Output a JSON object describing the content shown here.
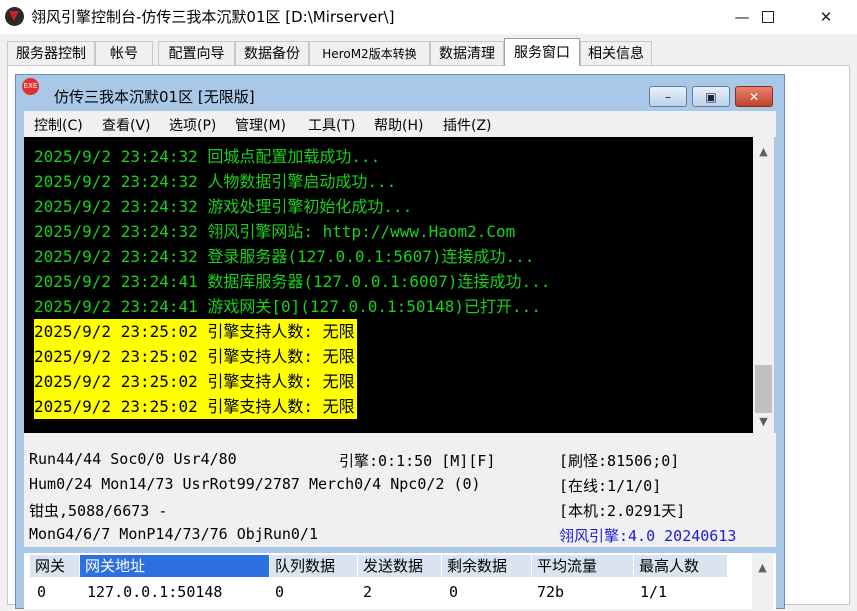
{
  "window": {
    "title": "翎风引擎控制台-仿传三我本沉默01区 [D:\\Mirserver\\]"
  },
  "tabs": [
    "服务器控制",
    "帐号",
    "配置向导",
    "数据备份",
    "HeroM2版本转换",
    "数据清理",
    "服务窗口",
    "相关信息"
  ],
  "active_tab": "服务窗口",
  "inner": {
    "title": "仿传三我本沉默01区 [无限版]",
    "icon_text": "EXE"
  },
  "menu": [
    "控制(C)",
    "查看(V)",
    "选项(P)",
    "管理(M)",
    "工具(T)",
    "帮助(H)",
    "插件(Z)"
  ],
  "log": [
    {
      "text": "2025/9/2 23:24:32 回城点配置加载成功...",
      "style": "green"
    },
    {
      "text": "2025/9/2 23:24:32 人物数据引擎启动成功...",
      "style": "green"
    },
    {
      "text": "2025/9/2 23:24:32 游戏处理引擎初始化成功...",
      "style": "green"
    },
    {
      "text": "2025/9/2 23:24:32 翎风引擎网站: http://www.Haom2.Com",
      "style": "green"
    },
    {
      "text": "2025/9/2 23:24:32 登录服务器(127.0.0.1:5607)连接成功...",
      "style": "green"
    },
    {
      "text": "2025/9/2 23:24:41 数据库服务器(127.0.0.1:6007)连接成功...",
      "style": "green"
    },
    {
      "text": "2025/9/2 23:24:41 游戏网关[0](127.0.0.1:50148)已打开...",
      "style": "green"
    },
    {
      "text": "2025/9/2 23:25:02 引擎支持人数: 无限",
      "style": "yellow"
    },
    {
      "text": "2025/9/2 23:25:02 引擎支持人数: 无限",
      "style": "yellow"
    },
    {
      "text": "2025/9/2 23:25:02 引擎支持人数: 无限",
      "style": "yellow"
    },
    {
      "text": "2025/9/2 23:25:02 引擎支持人数: 无限",
      "style": "yellow"
    }
  ],
  "status": {
    "run": "Run44/44 Soc0/0 Usr4/80",
    "engine_time": "引擎:0:1:50 [M][F]",
    "monster": "[刷怪:81506;0]",
    "hum": "Hum0/24 Mon14/73 UsrRot99/2787 Merch0/4 Npc0/2 (0)",
    "online": "[在线:1/1/0]",
    "bug": "钳虫,5088/6673 -",
    "local": "[本机:2.0291天]",
    "mong": "MonG4/6/7 MonP14/73/76 ObjRun0/1",
    "version": "翎风引擎:4.0 20240613"
  },
  "grid": {
    "headers": [
      "网关",
      "网关地址",
      "队列数据",
      "发送数据",
      "剩余数据",
      "平均流量",
      "最高人数"
    ],
    "rows": [
      [
        "0",
        "127.0.0.1:50148",
        "0",
        "2",
        "0",
        "72b",
        "1/1"
      ]
    ]
  },
  "colors": {
    "log_green": "#19d119",
    "highlight_yellow": "#ffff00",
    "version_blue": "#1c1cd8"
  }
}
